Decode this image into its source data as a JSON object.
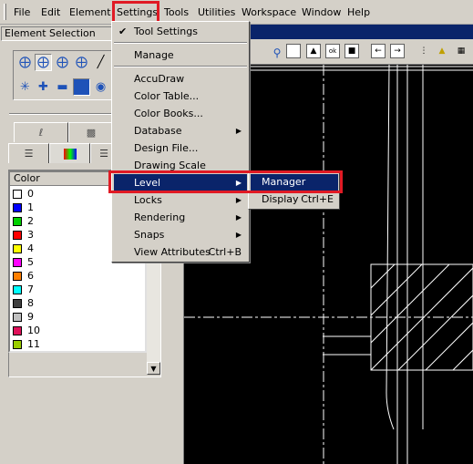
{
  "menubar": {
    "items": [
      "File",
      "Edit",
      "Element",
      "Settings",
      "Tools",
      "Utilities",
      "Workspace",
      "Window",
      "Help"
    ]
  },
  "panel": {
    "title": "Element Selection",
    "list_header": "Color",
    "colors": [
      {
        "label": "0",
        "color": "#ffffff"
      },
      {
        "label": "1",
        "color": "#0000ff"
      },
      {
        "label": "2",
        "color": "#00d000"
      },
      {
        "label": "3",
        "color": "#ff0000"
      },
      {
        "label": "4",
        "color": "#ffff00"
      },
      {
        "label": "5",
        "color": "#ff00ff"
      },
      {
        "label": "6",
        "color": "#ff7f00"
      },
      {
        "label": "7",
        "color": "#00ffff"
      },
      {
        "label": "8",
        "color": "#404040"
      },
      {
        "label": "9",
        "color": "#c0c0c0"
      },
      {
        "label": "10",
        "color": "#e0105a"
      },
      {
        "label": "11",
        "color": "#9acd00"
      }
    ]
  },
  "settings_menu": {
    "tool_settings": "Tool Settings",
    "manage": "Manage",
    "accudraw": "AccuDraw",
    "color_table": "Color Table...",
    "color_books": "Color Books...",
    "database": "Database",
    "design_file": "Design File...",
    "drawing_scale": "Drawing Scale",
    "level": "Level",
    "locks": "Locks",
    "rendering": "Rendering",
    "snaps": "Snaps",
    "view_attributes": "View Attributes",
    "view_attributes_shortcut": "Ctrl+B"
  },
  "level_submenu": {
    "manager": "Manager",
    "display": "Display",
    "display_shortcut": "Ctrl+E"
  },
  "colors": {
    "highlight_red": "#e01a24",
    "selection_blue": "#0a246a"
  }
}
